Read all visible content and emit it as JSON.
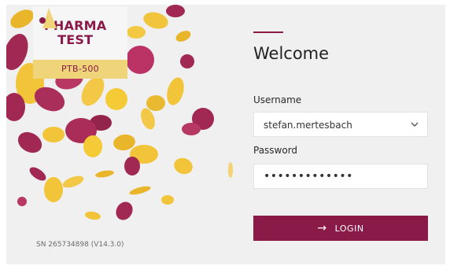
{
  "brand": {
    "line1": "PHARMA",
    "line2": "TEST",
    "model": "PTB-500"
  },
  "device": {
    "serial": "SN 265734898 (V14.3.0)"
  },
  "login_form": {
    "heading": "Welcome",
    "username_label": "Username",
    "username_value": "stefan.mertesbach",
    "password_label": "Password",
    "password_value": "•••••••••••••",
    "login_label": "LOGIN"
  },
  "icons": {
    "dropdown": "chevron-down-icon",
    "login_arrow": "arrow-right-icon"
  },
  "colors": {
    "accent": "#8a1a47",
    "brand_gold": "#f0d47a",
    "background": "#f0f0f0"
  }
}
